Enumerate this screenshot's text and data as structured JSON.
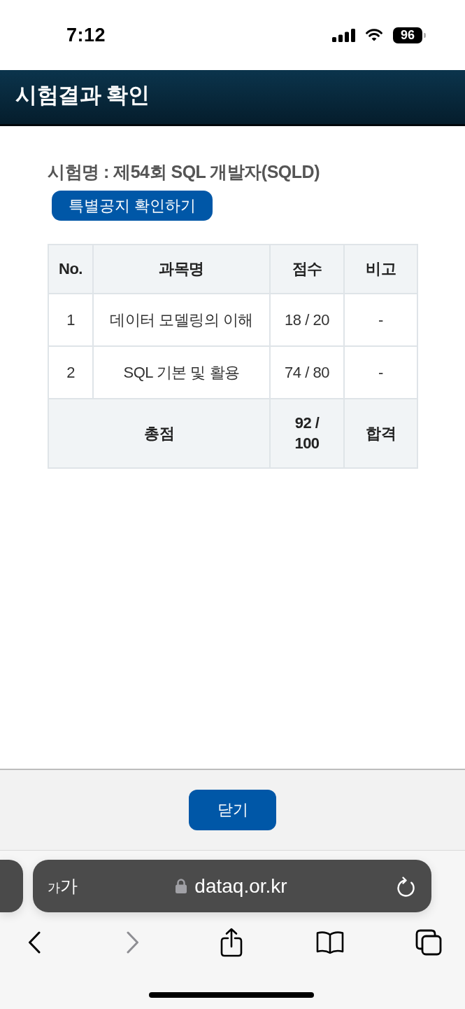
{
  "status_bar": {
    "time": "7:12",
    "battery": "96"
  },
  "header": {
    "title": "시험결과 확인"
  },
  "exam": {
    "name": "시험명 : 제54회 SQL 개발자(SQLD)",
    "notice_button": "특별공지 확인하기"
  },
  "table": {
    "columns": [
      "No.",
      "과목명",
      "점수",
      "비고"
    ],
    "rows": [
      {
        "no": "1",
        "subject": "데이터 모델링의 이해",
        "score": "18 / 20",
        "note": "-"
      },
      {
        "no": "2",
        "subject": "SQL 기본 및 활용",
        "score": "74 / 80",
        "note": "-"
      }
    ],
    "total": {
      "label": "총점",
      "score": "92 / 100",
      "result": "합격"
    }
  },
  "footer": {
    "close_button": "닫기"
  },
  "browser": {
    "text_size": {
      "small": "가",
      "large": "가"
    },
    "url": "dataq.or.kr",
    "toolbar": [
      {
        "kind": "back",
        "disabled": false
      },
      {
        "kind": "forward",
        "disabled": true
      },
      {
        "kind": "share",
        "disabled": false
      },
      {
        "kind": "bookmarks",
        "disabled": false
      },
      {
        "kind": "tabs",
        "disabled": false
      }
    ]
  }
}
